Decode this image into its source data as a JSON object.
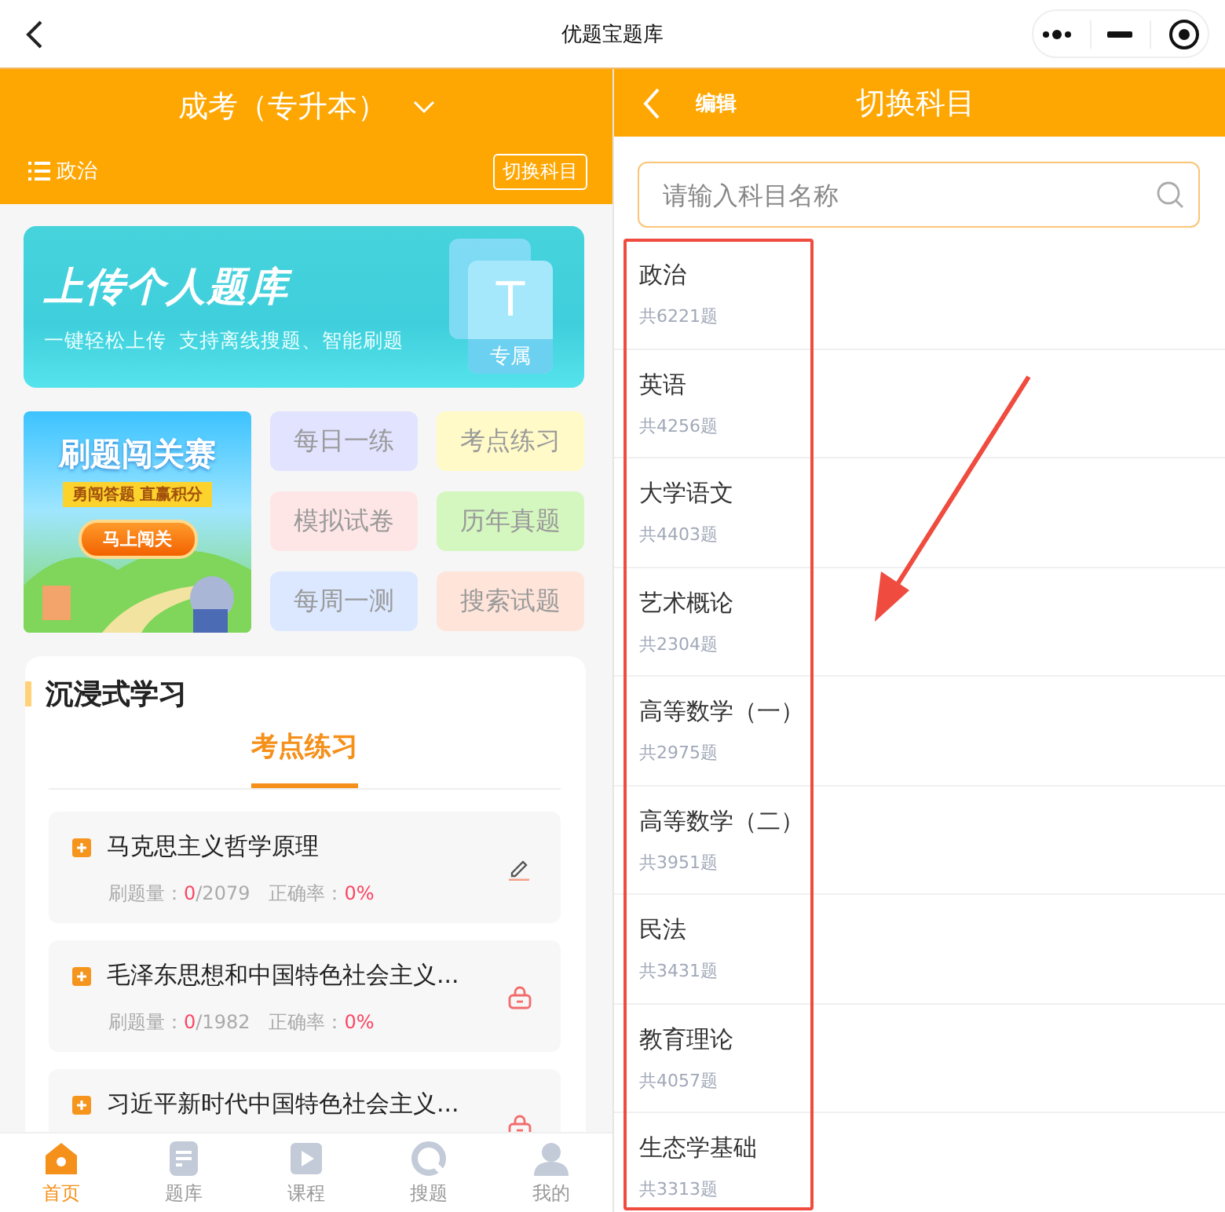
{
  "window": {
    "title": "优题宝题库"
  },
  "left": {
    "exam": "成考（专升本）",
    "subject": "政治",
    "switch_button": "切换科目",
    "banner": {
      "title": "上传个人题库",
      "subtitle": "一键轻松上传  支持离线搜题、智能刷题",
      "badge_letter": "T",
      "badge_label": "专属"
    },
    "promo": {
      "title": "刷题闯关赛",
      "ribbon": "勇闯答题 直赢积分",
      "button": "马上闯关"
    },
    "shortcuts": [
      {
        "label": "每日一练",
        "color": "#e1e3ff"
      },
      {
        "label": "考点练习",
        "color": "#fffac8"
      },
      {
        "label": "模拟试卷",
        "color": "#ffe6e6"
      },
      {
        "label": "历年真题",
        "color": "#d4f7bf"
      },
      {
        "label": "每周一测",
        "color": "#dbe8ff"
      },
      {
        "label": "搜索试题",
        "color": "#ffe4da"
      }
    ],
    "section": {
      "title": "沉浸式学习",
      "tabs": [
        {
          "label": "考点练习",
          "selected": true
        }
      ]
    },
    "chapters": [
      {
        "title": "马克思主义哲学原理",
        "count_label": "刷题量：",
        "done": "0",
        "total": "/2079",
        "rate_label": "正确率：",
        "rate": "0%",
        "locked": false
      },
      {
        "title": "毛泽东思想和中国特色社会主义...",
        "count_label": "刷题量：",
        "done": "0",
        "total": "/1982",
        "rate_label": "正确率：",
        "rate": "0%",
        "locked": true
      },
      {
        "title": "习近平新时代中国特色社会主义...",
        "locked": true
      }
    ],
    "tabbar": [
      {
        "label": "首页",
        "kind": "home",
        "selected": true
      },
      {
        "label": "题库",
        "kind": "bank",
        "selected": false
      },
      {
        "label": "课程",
        "kind": "course",
        "selected": false
      },
      {
        "label": "搜题",
        "kind": "search",
        "selected": false
      },
      {
        "label": "我的",
        "kind": "profile",
        "selected": false
      }
    ]
  },
  "right": {
    "edit": "编辑",
    "title": "切换科目",
    "search": {
      "placeholder": "请输入科目名称"
    },
    "subjects": [
      {
        "name": "政治",
        "count": "共6221题"
      },
      {
        "name": "英语",
        "count": "共4256题"
      },
      {
        "name": "大学语文",
        "count": "共4403题"
      },
      {
        "name": "艺术概论",
        "count": "共2304题"
      },
      {
        "name": "高等数学（一）",
        "count": "共2975题"
      },
      {
        "name": "高等数学（二）",
        "count": "共3951题"
      },
      {
        "name": "民法",
        "count": "共3431题"
      },
      {
        "name": "教育理论",
        "count": "共4057题"
      },
      {
        "name": "生态学基础",
        "count": "共3313题"
      }
    ]
  }
}
